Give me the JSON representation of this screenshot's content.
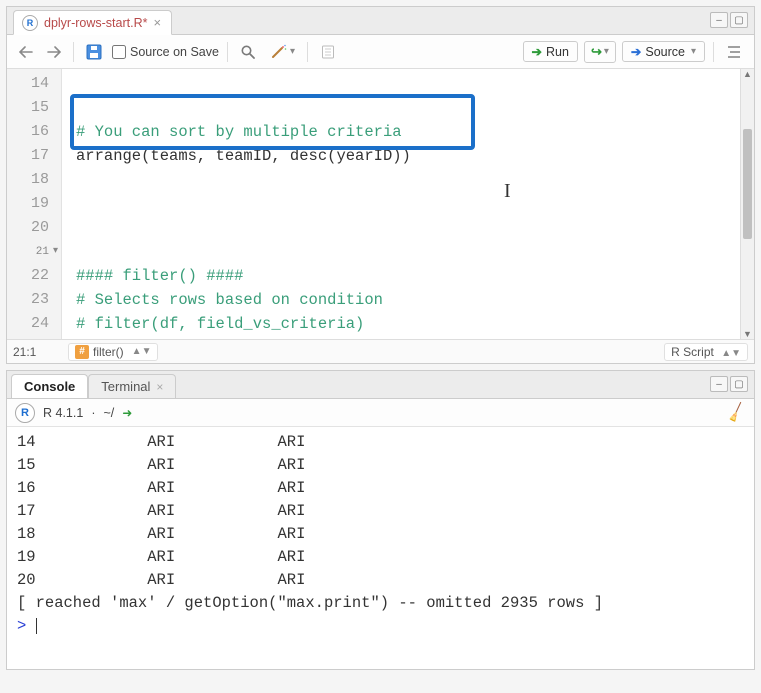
{
  "source": {
    "tab_name": "dplyr-rows-start.R*",
    "save_on_save_label": "Source on Save",
    "run_label": "Run",
    "source_label": "Source",
    "status_pos": "21:1",
    "status_crumb": "filter()",
    "status_lang": "R Script",
    "lines": [
      {
        "n": "14",
        "text": ""
      },
      {
        "n": "15",
        "text": "# You can sort by multiple criteria",
        "cls": "comment"
      },
      {
        "n": "16",
        "text": "arrange(teams, teamID, desc(yearID))",
        "cls": "func"
      },
      {
        "n": "17",
        "text": ""
      },
      {
        "n": "18",
        "text": ""
      },
      {
        "n": "19",
        "text": ""
      },
      {
        "n": "20",
        "text": ""
      },
      {
        "n": "21",
        "text": "#### filter() ####",
        "cls": "comment",
        "fold": true
      },
      {
        "n": "22",
        "text": "# Selects rows based on condition",
        "cls": "comment"
      },
      {
        "n": "23",
        "text": "# filter(df, field_vs_criteria)",
        "cls": "comment"
      },
      {
        "n": "24",
        "text": ""
      }
    ]
  },
  "console": {
    "tab_console": "Console",
    "tab_terminal": "Terminal",
    "version": "R 4.1.1",
    "wd": "~/",
    "rows": [
      {
        "n": "14",
        "c1": "ARI",
        "c2": "ARI"
      },
      {
        "n": "15",
        "c1": "ARI",
        "c2": "ARI"
      },
      {
        "n": "16",
        "c1": "ARI",
        "c2": "ARI"
      },
      {
        "n": "17",
        "c1": "ARI",
        "c2": "ARI"
      },
      {
        "n": "18",
        "c1": "ARI",
        "c2": "ARI"
      },
      {
        "n": "19",
        "c1": "ARI",
        "c2": "ARI"
      },
      {
        "n": "20",
        "c1": "ARI",
        "c2": "ARI"
      }
    ],
    "omitted_msg": "[ reached 'max' / getOption(\"max.print\") -- omitted 2935 rows ]",
    "prompt": "> "
  },
  "icons": {
    "back": "←",
    "fwd": "→",
    "save": "💾",
    "find": "🔍",
    "wand": "✨",
    "notebook": "▭",
    "outline": "≣"
  }
}
